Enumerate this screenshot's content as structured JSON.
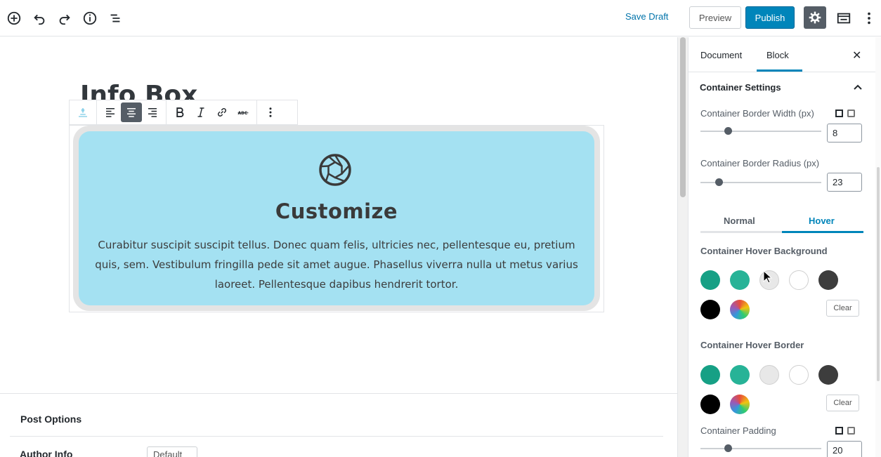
{
  "topbar": {
    "save_draft": "Save Draft",
    "preview": "Preview",
    "publish": "Publish",
    "accent": "#0085ba"
  },
  "editor": {
    "post_title": "Info Box",
    "info_box": {
      "heading": "Customize",
      "text": "Curabitur suscipit suscipit tellus. Donec quam felis, ultricies nec, pellentesque eu, pretium quis, sem. Vestibulum fringilla pede sit amet augue. Phasellus viverra nulla ut metus varius laoreet. Pellentesque dapibus hendrerit tortor.",
      "background": "#a4e1f2",
      "border_color": "#e4e4e4",
      "icon": "aperture-icon"
    }
  },
  "post_options": {
    "title": "Post Options",
    "author_label": "Author Info",
    "author_value": "Default"
  },
  "sidebar": {
    "tabs": [
      "Document",
      "Block"
    ],
    "active_tab": "Block",
    "panel_title": "Container Settings",
    "border_width": {
      "label": "Container Border Width (px)",
      "value": "8"
    },
    "border_radius": {
      "label": "Container Border Radius (px)",
      "value": "23"
    },
    "state_tabs": {
      "normal": "Normal",
      "hover": "Hover",
      "active": "Hover"
    },
    "hover_background": {
      "label": "Container Hover Background",
      "colors": [
        "#16a085",
        "#27b397",
        "#e8e8e8",
        "#ffffff",
        "#3d3d3d",
        "#000000"
      ],
      "clear": "Clear"
    },
    "hover_border": {
      "label": "Container Hover Border",
      "colors": [
        "#16a085",
        "#27b397",
        "#e8e8e8",
        "#ffffff",
        "#3d3d3d",
        "#000000"
      ],
      "clear": "Clear"
    },
    "padding": {
      "label": "Container Padding",
      "value": "20"
    }
  }
}
